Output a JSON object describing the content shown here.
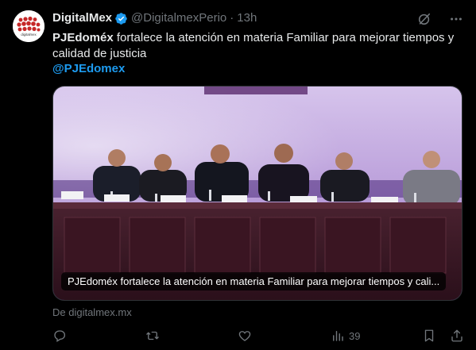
{
  "account": {
    "display_name": "DigitalMex",
    "handle": "@DigitalmexPerio",
    "separator": "·",
    "time": "13h",
    "avatar_text": "digitalmex"
  },
  "tweet": {
    "text_bold": "PJEdoméx",
    "text_rest": " fortalece la atención en materia Familiar para mejorar tiempos y calidad de justicia",
    "mention": "@PJEdomex"
  },
  "media": {
    "caption": "PJEdoméx fortalece la atención en materia Familiar para mejorar tiempos y cali..."
  },
  "source": "De digitalmex.mx",
  "actions": {
    "views_count": "39"
  },
  "colors": {
    "background": "#000000",
    "text": "#e7e9ea",
    "muted": "#71767b",
    "link": "#1d9bf0",
    "verified": "#1d9bf0"
  },
  "icons": {
    "verified": "verified-badge-icon",
    "grok": "grok-icon",
    "more": "more-icon",
    "reply": "reply-icon",
    "repost": "repost-icon",
    "like": "like-icon",
    "views": "views-icon",
    "bookmark": "bookmark-icon",
    "share": "share-icon"
  }
}
